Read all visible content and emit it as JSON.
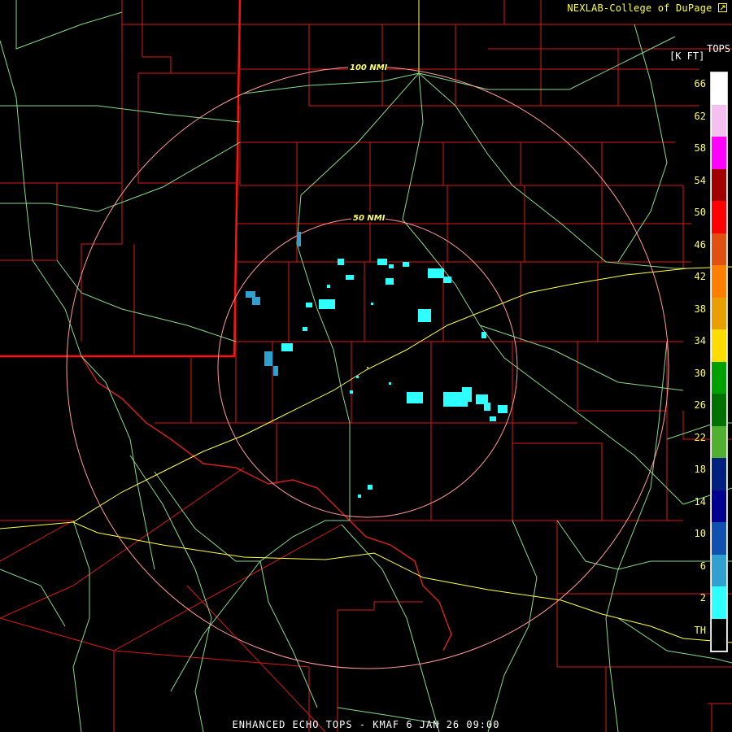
{
  "header": {
    "credit": "NEXLAB-College of DuPage",
    "credit_icon": "expand-arrow-icon"
  },
  "legend": {
    "title_line1": "TOPS",
    "title_line2": "[K FT]",
    "labels": [
      "66",
      "62",
      "58",
      "54",
      "50",
      "46",
      "42",
      "38",
      "34",
      "30",
      "26",
      "22",
      "18",
      "14",
      "10",
      "6",
      "2",
      "TH"
    ],
    "colors": [
      "#ffffff",
      "#f5c0f0",
      "#ff00ff",
      "#a00000",
      "#ff0000",
      "#e05010",
      "#ff7f00",
      "#e8a000",
      "#ffdd00",
      "#00a000",
      "#007000",
      "#50b030",
      "#002080",
      "#000090",
      "#1050b0",
      "#30a0d0",
      "#30ffff",
      "#000000"
    ]
  },
  "range_rings": {
    "inner": "50 NMI",
    "outer": "100 NMI",
    "color": "#ff9999"
  },
  "colors": {
    "county_lines": "#d81818",
    "state_line": "#ff1010",
    "roads": "#88d888",
    "interstate": "#ffff44"
  },
  "footer": {
    "title": "ENHANCED ECHO TOPS - KMAF 6 JAN 26 09:00"
  }
}
